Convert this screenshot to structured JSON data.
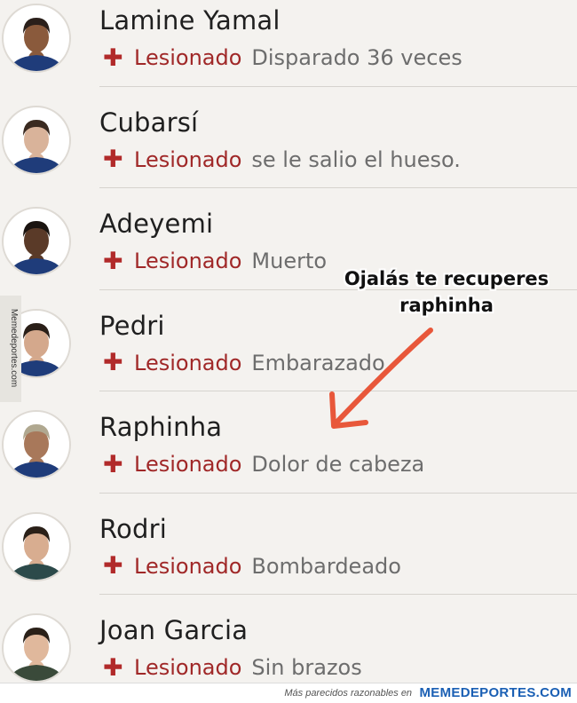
{
  "players": [
    {
      "name": "Lamine Yamal",
      "status": "Lesionado",
      "detail": "Disparado 36 veces",
      "kit": "#1f3c7a",
      "skin": "#8a5a3c",
      "hair": "#2a1f1a"
    },
    {
      "name": "Cubarsí",
      "status": "Lesionado",
      "detail": "se le salio el hueso.",
      "kit": "#1f3c7a",
      "skin": "#d9b39a",
      "hair": "#3a2a20"
    },
    {
      "name": "Adeyemi",
      "status": "Lesionado",
      "detail": "Muerto",
      "kit": "#1f3c7a",
      "skin": "#5a3a28",
      "hair": "#1a1410"
    },
    {
      "name": "Pedri",
      "status": "Lesionado",
      "detail": "Embarazado",
      "kit": "#1f3c7a",
      "skin": "#d4a88c",
      "hair": "#2a1f18"
    },
    {
      "name": "Raphinha",
      "status": "Lesionado",
      "detail": "Dolor de cabeza",
      "kit": "#1f3c7a",
      "skin": "#a8785a",
      "hair": "#b0a890"
    },
    {
      "name": "Rodri",
      "status": "Lesionado",
      "detail": "Bombardeado",
      "kit": "#2c4a4a",
      "skin": "#d8ad90",
      "hair": "#2a2018"
    },
    {
      "name": "Joan Garcia",
      "status": "Lesionado",
      "detail": "Sin brazos",
      "kit": "#3a4a3a",
      "skin": "#e0b89c",
      "hair": "#2a2018"
    }
  ],
  "annotation": {
    "line1": "Ojalás te recuperes",
    "line2": "raphinha",
    "arrow_color": "#e8573a"
  },
  "watermark": {
    "side": "Memedeportes.com",
    "footer_text": "Más parecidos razonables en",
    "footer_brand": "MEMEDEPORTES.COM"
  },
  "icons": {
    "status": "red-cross-icon"
  },
  "colors": {
    "status": "#a02828",
    "detail": "#6d6d6d",
    "background": "#f4f2ef"
  }
}
